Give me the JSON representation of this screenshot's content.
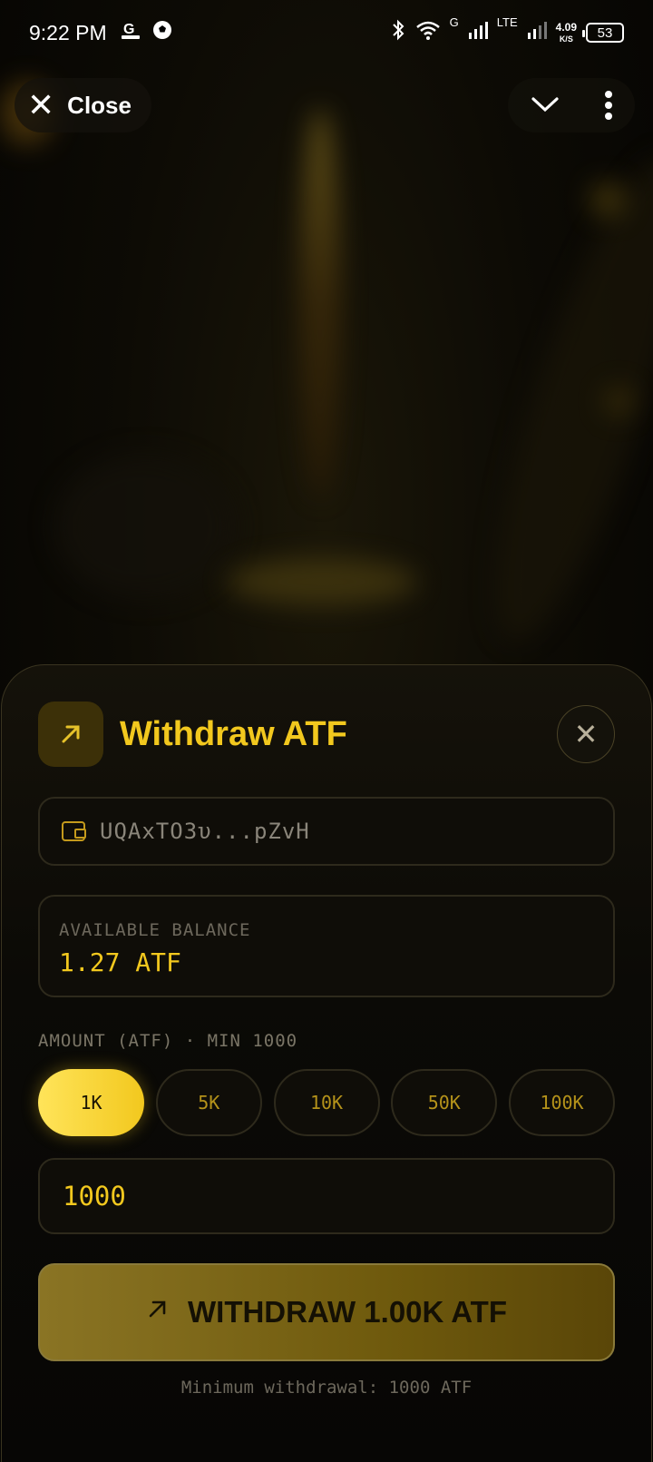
{
  "status_bar": {
    "time": "9:22 PM",
    "network_speed": "4.09",
    "network_speed_unit": "K/S",
    "network_type_1": "G",
    "network_type_2": "LTE",
    "battery": "53",
    "icons": [
      "gplay-games-icon",
      "soccer-ball-icon",
      "bluetooth-icon",
      "wifi-icon",
      "signal-icon",
      "signal-icon-2",
      "battery-icon"
    ]
  },
  "top_bar": {
    "close_label": "Close",
    "icons": [
      "close-icon",
      "chevron-down-icon",
      "more-vertical-icon"
    ]
  },
  "sheet": {
    "title": "Withdraw ATF",
    "wallet_address": "UQAxTO3υ...pZvH",
    "balance_label": "AVAILABLE BALANCE",
    "balance_value": "1.27 ATF",
    "amount_label": "AMOUNT (ATF) · MIN 1000",
    "presets": [
      {
        "label": "1K",
        "active": true
      },
      {
        "label": "5K",
        "active": false
      },
      {
        "label": "10K",
        "active": false
      },
      {
        "label": "50K",
        "active": false
      },
      {
        "label": "100K",
        "active": false
      }
    ],
    "amount_value": "1000",
    "withdraw_button": "WITHDRAW 1.00K ATF",
    "min_note": "Minimum withdrawal: 1000 ATF"
  },
  "colors": {
    "accent": "#f2c81e",
    "background": "#050403",
    "card_border": "#2e2a1c"
  }
}
